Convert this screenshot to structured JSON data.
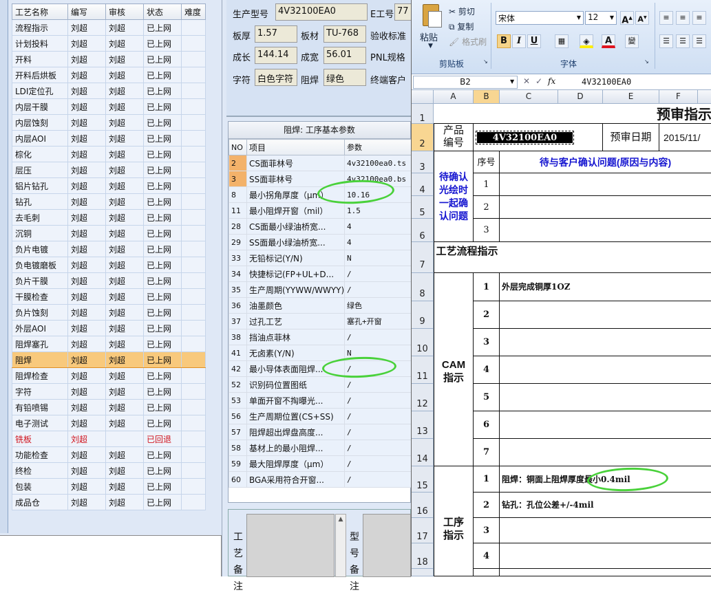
{
  "process_list": {
    "headers": [
      "工艺名称",
      "编写",
      "审核",
      "状态",
      "难度"
    ],
    "rows": [
      {
        "name": "流程指示",
        "author": "刘超",
        "reviewer": "刘超",
        "status": "已上网"
      },
      {
        "name": "计划投料",
        "author": "刘超",
        "reviewer": "刘超",
        "status": "已上网"
      },
      {
        "name": "开料",
        "author": "刘超",
        "reviewer": "刘超",
        "status": "已上网"
      },
      {
        "name": "开料后烘板",
        "author": "刘超",
        "reviewer": "刘超",
        "status": "已上网"
      },
      {
        "name": "LDI定位孔",
        "author": "刘超",
        "reviewer": "刘超",
        "status": "已上网"
      },
      {
        "name": "内层干膜",
        "author": "刘超",
        "reviewer": "刘超",
        "status": "已上网"
      },
      {
        "name": "内层蚀刻",
        "author": "刘超",
        "reviewer": "刘超",
        "status": "已上网"
      },
      {
        "name": "内层AOI",
        "author": "刘超",
        "reviewer": "刘超",
        "status": "已上网"
      },
      {
        "name": "棕化",
        "author": "刘超",
        "reviewer": "刘超",
        "status": "已上网"
      },
      {
        "name": "层压",
        "author": "刘超",
        "reviewer": "刘超",
        "status": "已上网"
      },
      {
        "name": "铝片钻孔",
        "author": "刘超",
        "reviewer": "刘超",
        "status": "已上网"
      },
      {
        "name": "钻孔",
        "author": "刘超",
        "reviewer": "刘超",
        "status": "已上网"
      },
      {
        "name": "去毛刺",
        "author": "刘超",
        "reviewer": "刘超",
        "status": "已上网"
      },
      {
        "name": "沉铜",
        "author": "刘超",
        "reviewer": "刘超",
        "status": "已上网"
      },
      {
        "name": "负片电镀",
        "author": "刘超",
        "reviewer": "刘超",
        "status": "已上网"
      },
      {
        "name": "负电镀磨板",
        "author": "刘超",
        "reviewer": "刘超",
        "status": "已上网"
      },
      {
        "name": "负片干膜",
        "author": "刘超",
        "reviewer": "刘超",
        "status": "已上网"
      },
      {
        "name": "干膜检查",
        "author": "刘超",
        "reviewer": "刘超",
        "status": "已上网"
      },
      {
        "name": "负片蚀刻",
        "author": "刘超",
        "reviewer": "刘超",
        "status": "已上网"
      },
      {
        "name": "外层AOI",
        "author": "刘超",
        "reviewer": "刘超",
        "status": "已上网"
      },
      {
        "name": "阻焊塞孔",
        "author": "刘超",
        "reviewer": "刘超",
        "status": "已上网"
      },
      {
        "name": "阻焊",
        "author": "刘超",
        "reviewer": "刘超",
        "status": "已上网"
      },
      {
        "name": "阻焊检查",
        "author": "刘超",
        "reviewer": "刘超",
        "status": "已上网"
      },
      {
        "name": "字符",
        "author": "刘超",
        "reviewer": "刘超",
        "status": "已上网"
      },
      {
        "name": "有铅喷锡",
        "author": "刘超",
        "reviewer": "刘超",
        "status": "已上网"
      },
      {
        "name": "电子测试",
        "author": "刘超",
        "reviewer": "刘超",
        "status": "已上网"
      },
      {
        "name": "铣板",
        "author": "刘超",
        "reviewer": "",
        "status": "已回退"
      },
      {
        "name": "功能检查",
        "author": "刘超",
        "reviewer": "刘超",
        "status": "已上网"
      },
      {
        "name": "终检",
        "author": "刘超",
        "reviewer": "刘超",
        "status": "已上网"
      },
      {
        "name": "包装",
        "author": "刘超",
        "reviewer": "刘超",
        "status": "已上网"
      },
      {
        "name": "成品仓",
        "author": "刘超",
        "reviewer": "刘超",
        "status": "已上网"
      }
    ]
  },
  "header_form": {
    "model_label": "生产型号",
    "model_value": "4V32100EA0",
    "eng_label": "E工号",
    "eng_value": "77",
    "thickness_label": "板厚",
    "thickness_value": "1.57",
    "material_label": "板材",
    "material_value": "TU-768",
    "acceptance_label": "验收标准",
    "length_label": "成长",
    "length_value": "144.14",
    "width_label": "成宽",
    "width_value": "56.01",
    "pnl_label": "PNL规格",
    "char_label": "字符",
    "char_value": "白色字符",
    "mask_label": "阻焊",
    "mask_value": "绿色",
    "customer_label": "终端客户"
  },
  "params": {
    "title": "阻焊: 工序基本参数",
    "col_no": "NO",
    "col_item": "项目",
    "col_value": "参数",
    "rows": [
      {
        "no": "2",
        "item": "CS面菲林号",
        "value": "4v32100ea0.ts"
      },
      {
        "no": "3",
        "item": "SS面菲林号",
        "value": "4v32100ea0.bs"
      },
      {
        "no": "8",
        "item": "最小拐角厚度（μm）",
        "value": "10.16"
      },
      {
        "no": "11",
        "item": "最小阻焊开窗（mil）",
        "value": "1.5"
      },
      {
        "no": "28",
        "item": "CS面最小绿油桥宽...",
        "value": "4"
      },
      {
        "no": "29",
        "item": "SS面最小绿油桥宽...",
        "value": "4"
      },
      {
        "no": "33",
        "item": "无铅标记(Y/N)",
        "value": "N"
      },
      {
        "no": "34",
        "item": "快捷标记(FP+UL+D...",
        "value": "/"
      },
      {
        "no": "35",
        "item": "生产周期(YYWW/WWYY)",
        "value": "/"
      },
      {
        "no": "36",
        "item": "油墨颜色",
        "value": "绿色"
      },
      {
        "no": "37",
        "item": "过孔工艺",
        "value": "塞孔+开窗"
      },
      {
        "no": "38",
        "item": "挡油点菲林",
        "value": "/"
      },
      {
        "no": "41",
        "item": "无卤素(Y/N)",
        "value": "N"
      },
      {
        "no": "42",
        "item": "最小导体表面阻焊...",
        "value": "/"
      },
      {
        "no": "52",
        "item": "识别码位置图纸",
        "value": "/"
      },
      {
        "no": "53",
        "item": "单面开窗不掏曝光...",
        "value": "/"
      },
      {
        "no": "56",
        "item": "生产周期位置(CS+SS)",
        "value": "/"
      },
      {
        "no": "57",
        "item": "阻焊超出焊盘高度...",
        "value": "/"
      },
      {
        "no": "58",
        "item": "基材上的最小阻焊...",
        "value": "/"
      },
      {
        "no": "59",
        "item": "最大阻焊厚度（μm）",
        "value": "/"
      },
      {
        "no": "60",
        "item": "BGA采用符合开窗...",
        "value": "/"
      }
    ]
  },
  "notes": {
    "process_note_label": "工艺备注",
    "model_note_label": "型号备注"
  },
  "excel": {
    "ribbon": {
      "paste": "粘贴",
      "cut": "剪切",
      "copy": "复制",
      "format_painter": "格式刷",
      "clipboard_group": "剪贴板",
      "font_name": "宋体",
      "font_size": "12",
      "font_group": "字体",
      "bold": "B",
      "italic": "I",
      "underline": "U"
    },
    "name_box": "B2",
    "formula": "4V32100EA0",
    "columns": [
      "A",
      "B",
      "C",
      "D",
      "E",
      "F"
    ],
    "title": "预审指示",
    "product_label": "产品编号",
    "product_value": "4V32100EA0",
    "review_date_label": "预审日期",
    "review_date_value": "2015/11/",
    "seq_label": "序号",
    "confirm_header": "待与客户确认问题(原因与内容)",
    "confirm_label": "待确认光绘时一起确认问题",
    "flow_label": "工艺流程指示",
    "cam_label": "CAM指示",
    "cam_note_1": "外层完成铜厚1OZ",
    "proc_label": "工序指示",
    "proc_note_1": "阻焊：铜面上阻焊厚度最小0.4mil",
    "proc_note_2": "钻孔：孔位公差+/-4mil",
    "row_numbers": [
      "1",
      "2",
      "3",
      "4",
      "5",
      "6",
      "7",
      "8",
      "9",
      "10",
      "11",
      "12",
      "13",
      "14",
      "15",
      "16",
      "17",
      "18"
    ]
  }
}
